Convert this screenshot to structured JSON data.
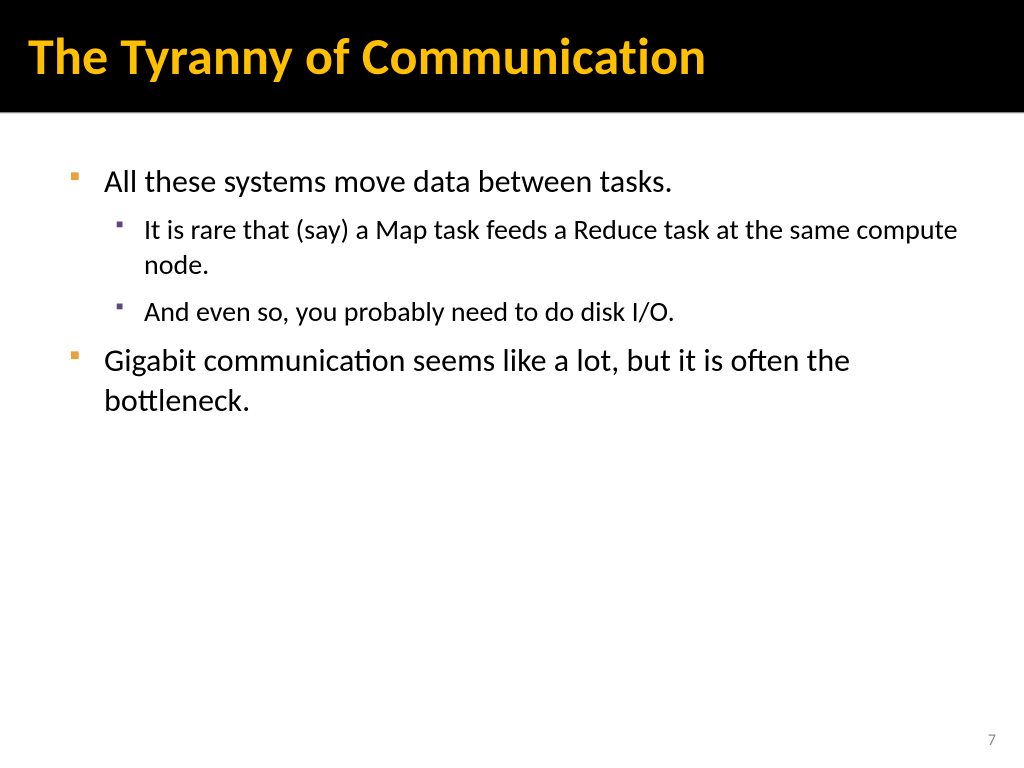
{
  "title": "The Tyranny of Communication",
  "bullets": {
    "b1": "All these systems move data between tasks.",
    "b1a": "It is rare that (say) a Map task feeds a Reduce task at the same compute node.",
    "b1b": "And even so, you probably need to do disk I/O.",
    "b2": "Gigabit communication seems like a lot, but it is often the bottleneck."
  },
  "page_number": "7"
}
